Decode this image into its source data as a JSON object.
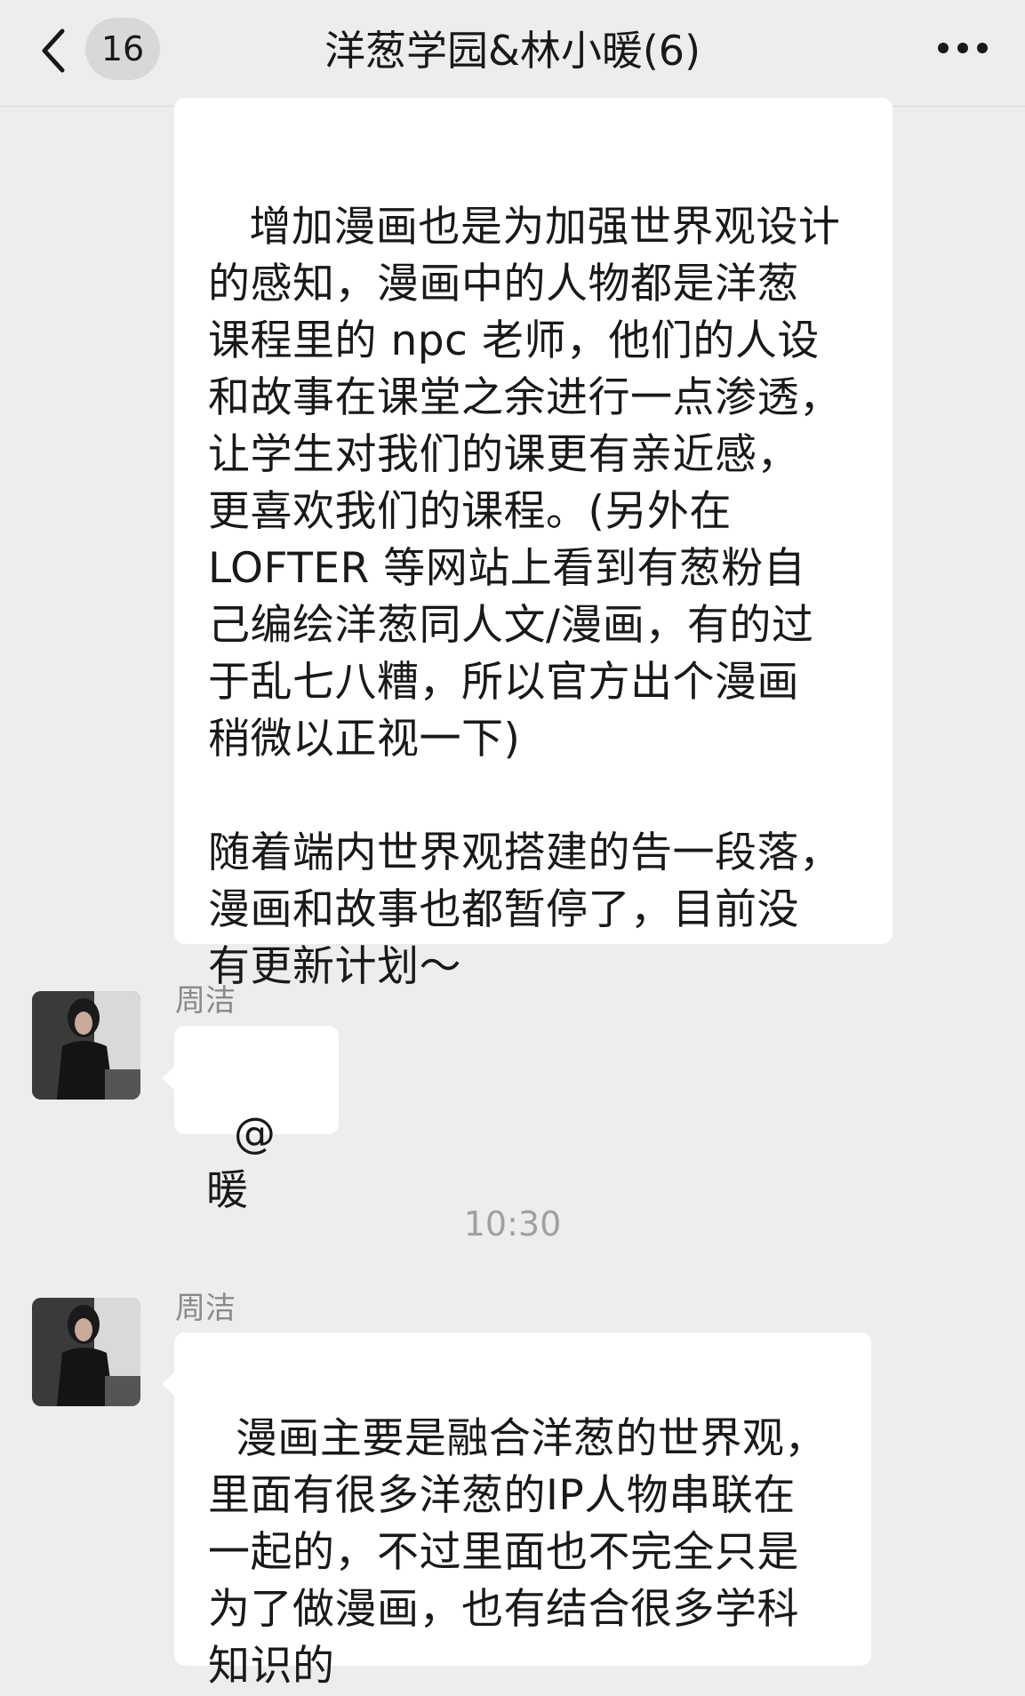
{
  "header": {
    "back_icon": "chevron-left-icon",
    "unread_count": "16",
    "title": "洋葱学园&林小暖(6)",
    "more_icon": "ellipsis-icon"
  },
  "messages": [
    {
      "text": " 增加漫画也是为加强世界观设计\n的感知，漫画中的人物都是洋葱\n课程里的 npc 老师，他们的人设\n和故事在课堂之余进行一点渗透，\n让学生对我们的课更有亲近感，\n更喜欢我们的课程。(另外在\nLOFTER 等网站上看到有葱粉自\n己编绘洋葱同人文/漫画，有的过\n于乱七八糟，所以官方出个漫画\n稍微以正视一下)\n\n随着端内世界观搭建的告一段落，\n漫画和故事也都暂停了，目前没\n有更新计划～"
    },
    {
      "sender": "周洁",
      "text": "@暖"
    },
    {
      "timestamp": "10:30"
    },
    {
      "sender": "周洁",
      "text": "漫画主要是融合洋葱的世界观，\n里面有很多洋葱的IP人物串联在\n一起的，不过里面也不完全只是\n为了做漫画，也有结合很多学科\n知识的"
    }
  ],
  "colors": {
    "background": "#ededed",
    "bubble": "#ffffff",
    "name_text": "#8a8a8a",
    "timestamp_text": "#a0a0a0"
  }
}
